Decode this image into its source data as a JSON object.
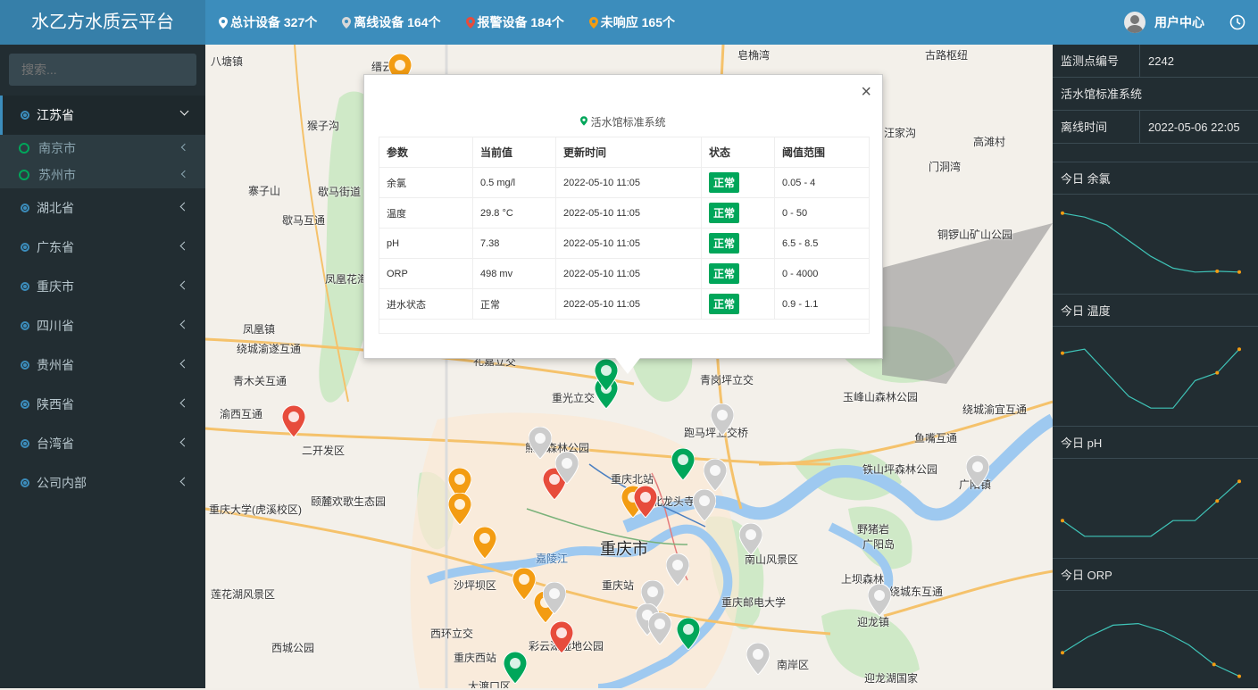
{
  "header": {
    "brand": "水乙方水质云平台",
    "stats": [
      {
        "label": "总计设备 327个",
        "color": "#ffffff"
      },
      {
        "label": "离线设备 164个",
        "color": "#d8d8d8"
      },
      {
        "label": "报警设备 184个",
        "color": "#e74c3c"
      },
      {
        "label": "未响应 165个",
        "color": "#f39c12"
      }
    ],
    "user_label": "用户中心",
    "icons": {
      "user": "avatar-icon",
      "clock": "clock-icon"
    }
  },
  "sidebar": {
    "search_placeholder": "搜索...",
    "menu": [
      {
        "label": "江苏省",
        "expanded": true,
        "children": [
          {
            "label": "南京市"
          },
          {
            "label": "苏州市"
          }
        ]
      },
      {
        "label": "湖北省"
      },
      {
        "label": "广东省"
      },
      {
        "label": "重庆市"
      },
      {
        "label": "四川省"
      },
      {
        "label": "贵州省"
      },
      {
        "label": "陕西省"
      },
      {
        "label": "台湾省"
      },
      {
        "label": "公司内部"
      }
    ]
  },
  "map": {
    "places": [
      "八塘镇",
      "缙云",
      "猴子沟",
      "寨子山",
      "歇马街道",
      "歇马互通",
      "凤凰花海",
      "凤凰镇",
      "绕城渝遂互通",
      "青木关互通",
      "渝西互通",
      "二开发区",
      "重庆大学(虎溪校区)",
      "颐麓欢歌生态园",
      "莲花湖风景区",
      "西城公园",
      "西环立交",
      "重庆西站",
      "大渡口区",
      "沙坪坝区",
      "嘉陵江",
      "重庆市",
      "重庆站",
      "重庆北站",
      "北龙头寺",
      "熊山森林公园",
      "重光立交",
      "青岗坪立交",
      "跑马坪立交桥",
      "南山风景区",
      "重庆邮电大学",
      "南岸区",
      "铁山坪森林公园",
      "野猪岩",
      "广阳岛",
      "上坝森林",
      "绕城东互通",
      "迎龙镇",
      "鱼嘴互通",
      "绕城渝宜互通",
      "玉峰山森林公园",
      "铜锣山矿山公园",
      "古路枢纽",
      "皂桷湾",
      "广阳镇",
      "迎龙湖国家",
      "礼嘉立交",
      "彩云湖湿地公园",
      "汪家沟",
      "高滩村",
      "门洞湾"
    ]
  },
  "popup": {
    "title": "活水馆标准系统",
    "close": "×",
    "headers": [
      "参数",
      "当前值",
      "更新时间",
      "状态",
      "阈值范围"
    ],
    "rows": [
      [
        "余氯",
        "0.5 mg/l",
        "2022-05-10 11:05",
        "正常",
        "0.05 - 4"
      ],
      [
        "温度",
        "29.8 °C",
        "2022-05-10 11:05",
        "正常",
        "0 - 50"
      ],
      [
        "pH",
        "7.38",
        "2022-05-10 11:05",
        "正常",
        "6.5 - 8.5"
      ],
      [
        "ORP",
        "498 mv",
        "2022-05-10 11:05",
        "正常",
        "0 - 4000"
      ],
      [
        "进水状态",
        "正常",
        "2022-05-10 11:05",
        "正常",
        "0.9 - 1.1"
      ]
    ]
  },
  "right_panel": {
    "point_id_label": "监测点编号",
    "point_id": "2242",
    "system_name": "活水馆标准系统",
    "offline_label": "离线时间",
    "offline_time": "2022-05-06 22:05",
    "charts": [
      {
        "title": "今日 余氯",
        "values": [
          0.9,
          0.85,
          0.75,
          0.55,
          0.35,
          0.2,
          0.15,
          0.16,
          0.15
        ]
      },
      {
        "title": "今日 温度",
        "values": [
          0.8,
          0.85,
          0.55,
          0.25,
          0.1,
          0.1,
          0.45,
          0.55,
          0.85
        ]
      },
      {
        "title": "今日 pH",
        "values": [
          0.35,
          0.15,
          0.15,
          0.15,
          0.15,
          0.35,
          0.35,
          0.6,
          0.85
        ]
      },
      {
        "title": "今日 ORP",
        "values": [
          0.35,
          0.55,
          0.7,
          0.72,
          0.62,
          0.45,
          0.2,
          0.05
        ]
      }
    ],
    "line_color": "#3fc4b8",
    "dot_color": "#f39c12"
  }
}
